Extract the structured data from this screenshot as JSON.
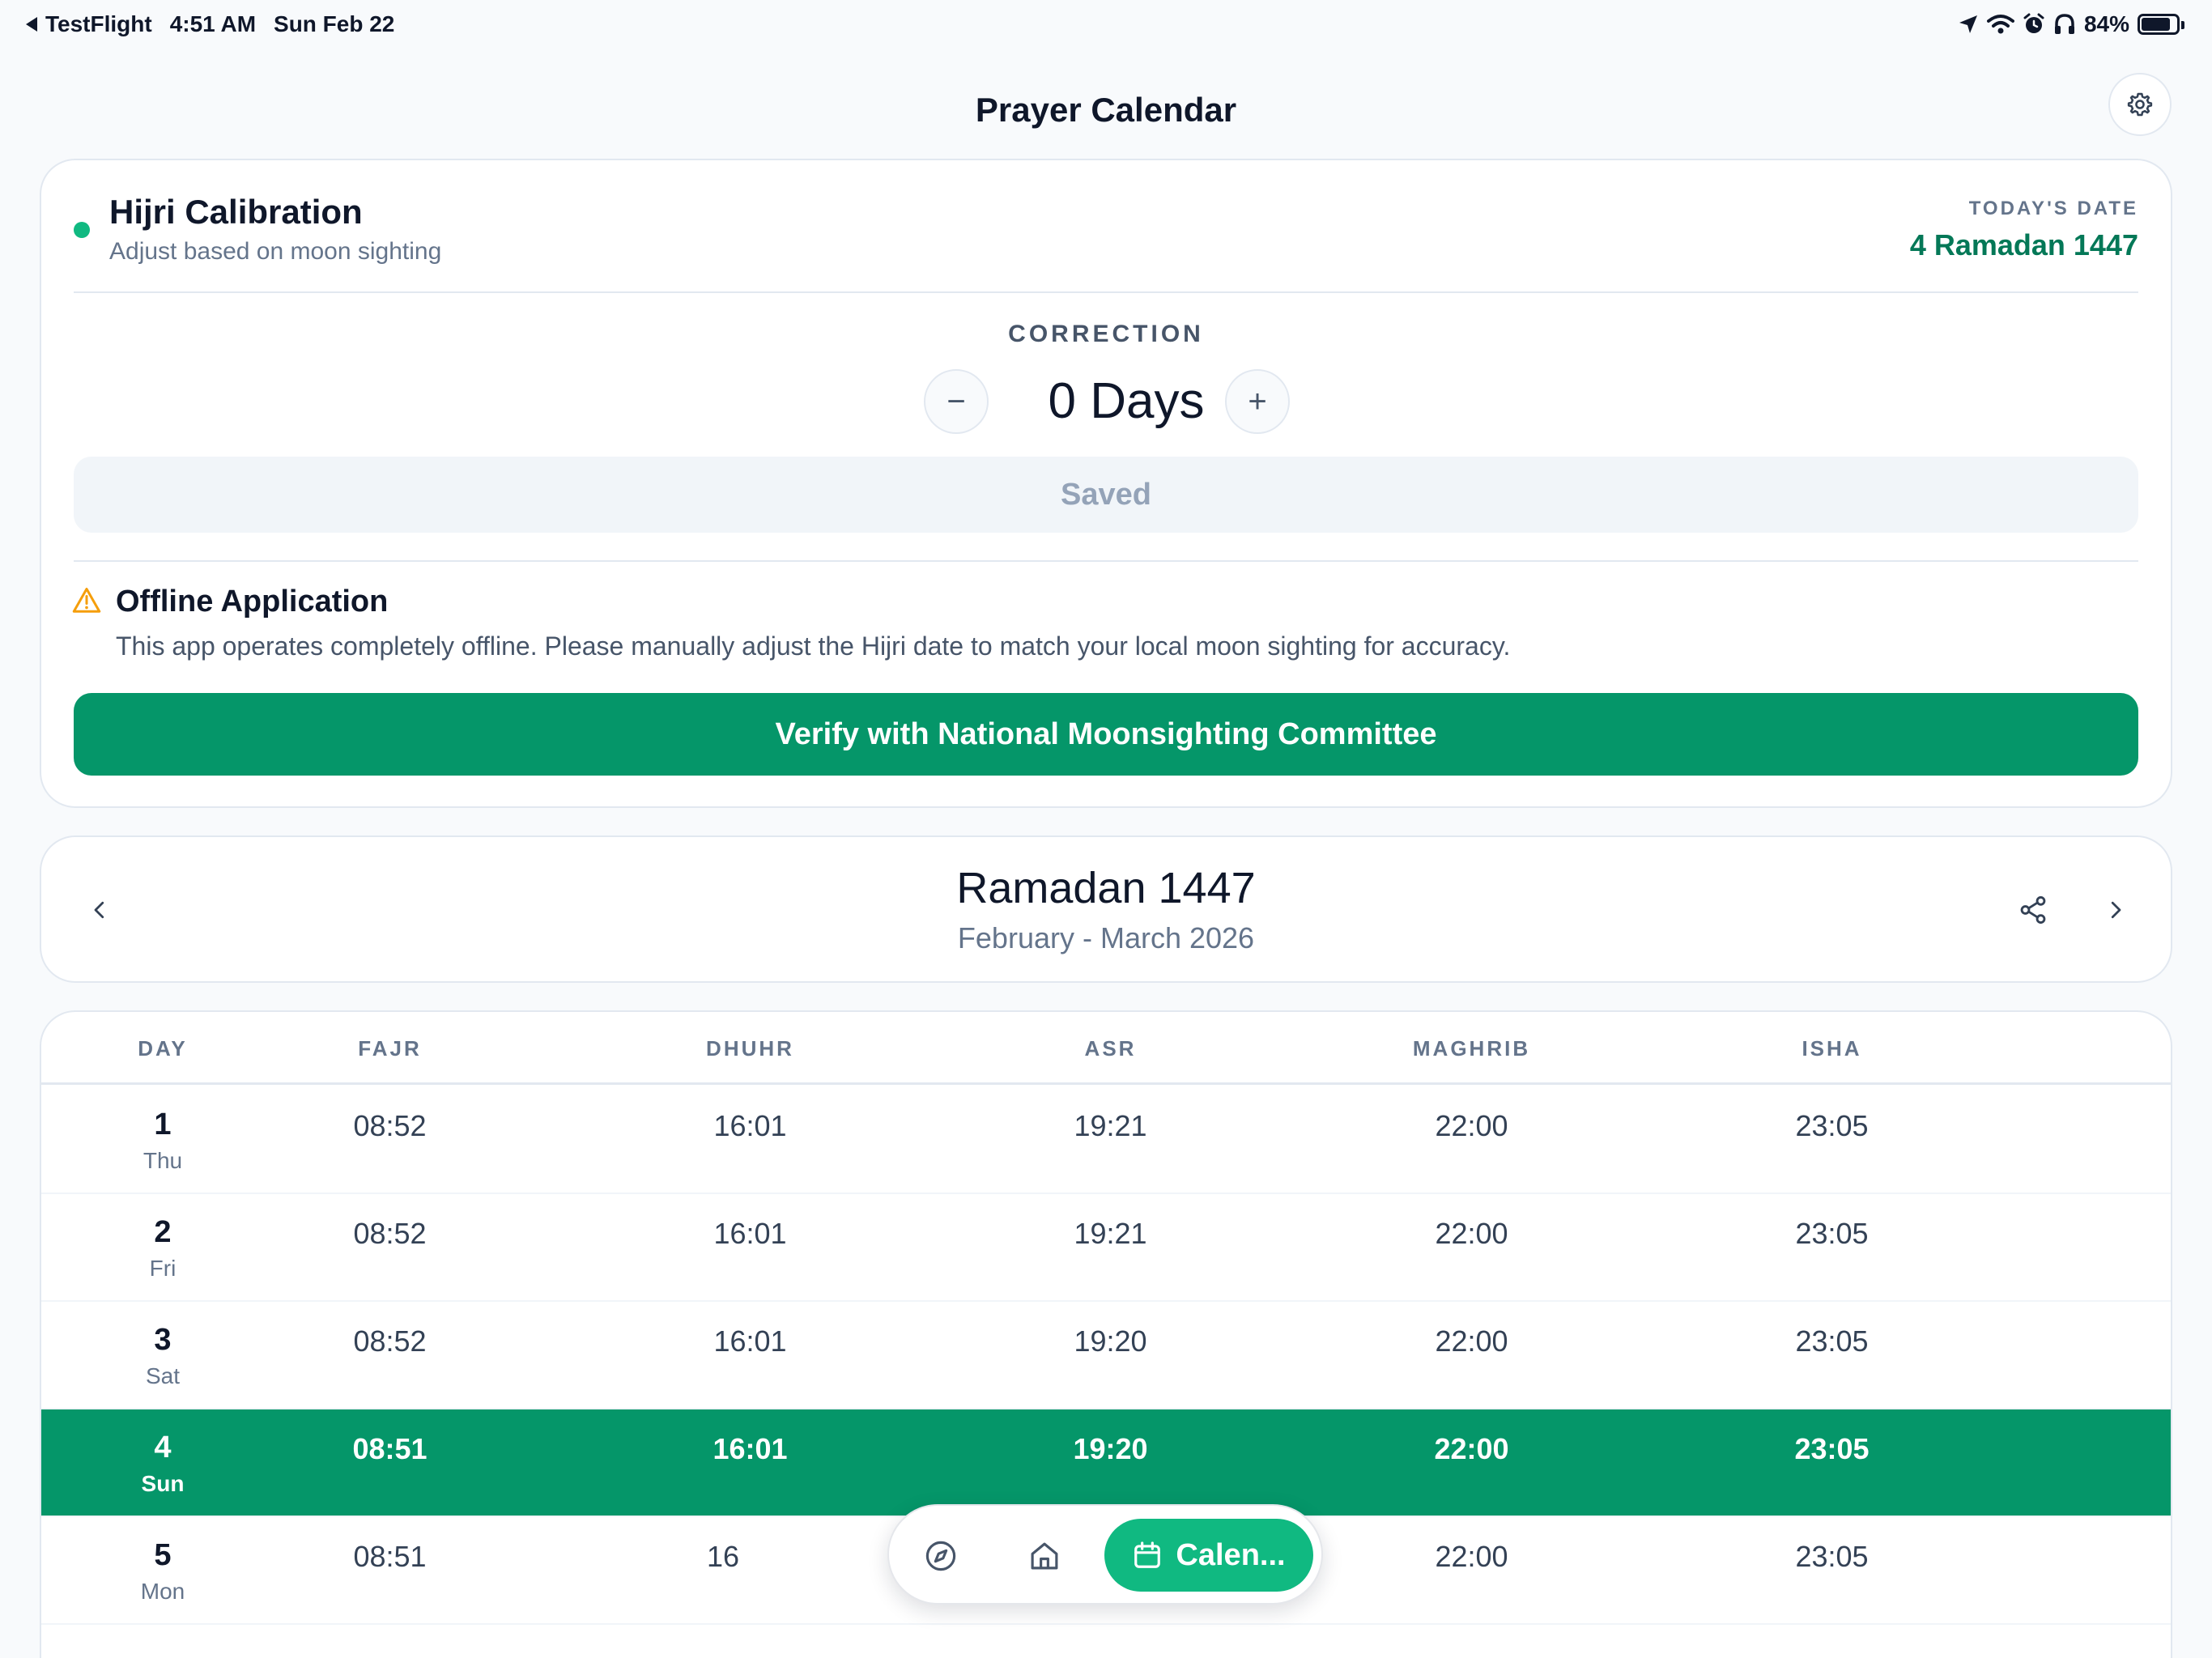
{
  "status_bar": {
    "back_app": "TestFlight",
    "time": "4:51 AM",
    "date": "Sun Feb 22",
    "battery": "84%",
    "battery_level": 0.84
  },
  "header": {
    "title": "Prayer Calendar"
  },
  "calibration": {
    "title": "Hijri Calibration",
    "subtitle": "Adjust based on moon sighting",
    "today_label": "TODAY'S DATE",
    "today_value": "4 Ramadan 1447",
    "correction_label": "CORRECTION",
    "minus_label": "−",
    "plus_label": "+",
    "correction_value": "0 Days",
    "saved_label": "Saved",
    "offline_title": "Offline Application",
    "offline_text": "This app operates completely offline. Please manually adjust the Hijri date to match your local moon sighting for accuracy.",
    "verify_label": "Verify with National Moonsighting Committee"
  },
  "month_nav": {
    "title": "Ramadan 1447",
    "subtitle": "February - March 2026"
  },
  "table": {
    "headers": [
      "DAY",
      "FAJR",
      "DHUHR",
      "ASR",
      "MAGHRIB",
      "ISHA"
    ],
    "rows": [
      {
        "day": "1",
        "weekday": "Thu",
        "fajr": "08:52",
        "dhuhr": "16:01",
        "asr": "19:21",
        "maghrib": "22:00",
        "isha": "23:05"
      },
      {
        "day": "2",
        "weekday": "Fri",
        "fajr": "08:52",
        "dhuhr": "16:01",
        "asr": "19:21",
        "maghrib": "22:00",
        "isha": "23:05"
      },
      {
        "day": "3",
        "weekday": "Sat",
        "fajr": "08:52",
        "dhuhr": "16:01",
        "asr": "19:20",
        "maghrib": "22:00",
        "isha": "23:05"
      },
      {
        "day": "4",
        "weekday": "Sun",
        "fajr": "08:51",
        "dhuhr": "16:01",
        "asr": "19:20",
        "maghrib": "22:00",
        "isha": "23:05"
      },
      {
        "day": "5",
        "weekday": "Mon",
        "fajr": "08:51",
        "dhuhr": "16",
        "asr": "",
        "maghrib": "22:00",
        "isha": "23:05"
      }
    ]
  },
  "tabbar": {
    "calendar_label": "Calen..."
  },
  "colors": {
    "accent": "#059669",
    "accent_light": "#10b981",
    "today_text": "#047857",
    "warning": "#f59e0b"
  }
}
